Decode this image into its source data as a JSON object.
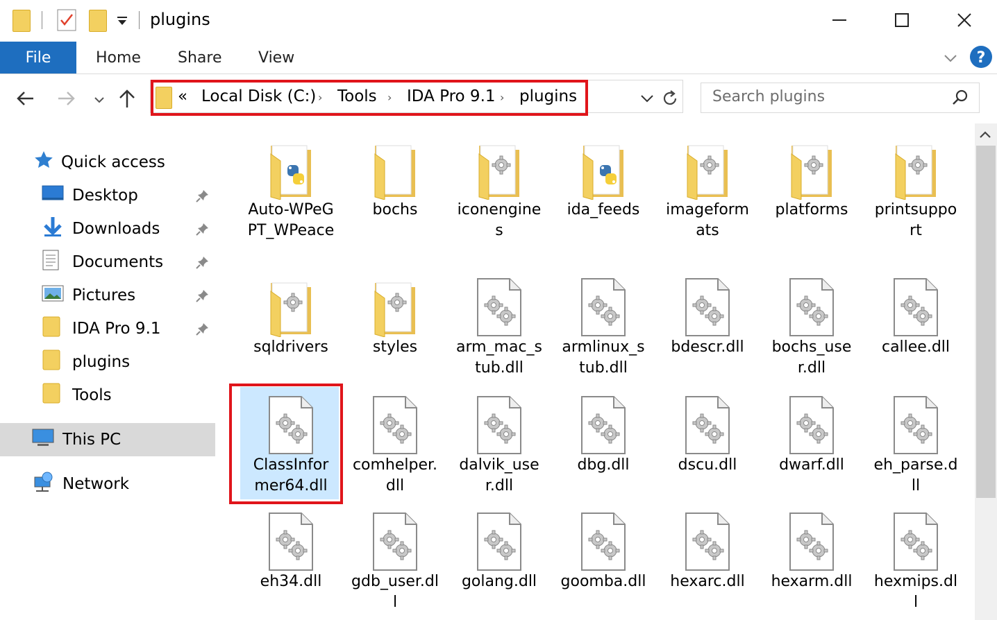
{
  "window": {
    "title": "plugins"
  },
  "ribbon": {
    "tabs": [
      "File",
      "Home",
      "Share",
      "View"
    ]
  },
  "address": {
    "overflow": "«",
    "crumbs": [
      "Local Disk (C:)",
      "Tools",
      "IDA Pro 9.1",
      "plugins"
    ]
  },
  "search": {
    "placeholder": "Search plugins"
  },
  "nav": {
    "quick_access": "Quick access",
    "items": [
      {
        "label": "Desktop",
        "icon": "desktop-icon",
        "pinned": true
      },
      {
        "label": "Downloads",
        "icon": "download-arrow-icon",
        "pinned": true
      },
      {
        "label": "Documents",
        "icon": "documents-icon",
        "pinned": true
      },
      {
        "label": "Pictures",
        "icon": "pictures-icon",
        "pinned": true
      },
      {
        "label": "IDA Pro 9.1",
        "icon": "folder-icon",
        "pinned": true
      },
      {
        "label": "plugins",
        "icon": "folder-icon",
        "pinned": false
      },
      {
        "label": "Tools",
        "icon": "folder-icon",
        "pinned": false
      }
    ],
    "this_pc": "This PC",
    "network": "Network"
  },
  "files": [
    {
      "name": "Auto-WPeGPT_WPeace",
      "type": "folder-python"
    },
    {
      "name": "bochs",
      "type": "folder"
    },
    {
      "name": "iconengines",
      "type": "folder-gear"
    },
    {
      "name": "ida_feeds",
      "type": "folder-python"
    },
    {
      "name": "imageformats",
      "type": "folder-gear"
    },
    {
      "name": "platforms",
      "type": "folder-gear"
    },
    {
      "name": "printsupport",
      "type": "folder-gear"
    },
    {
      "name": "sqldrivers",
      "type": "folder-gear"
    },
    {
      "name": "styles",
      "type": "folder-gear"
    },
    {
      "name": "arm_mac_stub.dll",
      "type": "dll"
    },
    {
      "name": "armlinux_stub.dll",
      "type": "dll"
    },
    {
      "name": "bdescr.dll",
      "type": "dll"
    },
    {
      "name": "bochs_user.dll",
      "type": "dll"
    },
    {
      "name": "callee.dll",
      "type": "dll"
    },
    {
      "name": "ClassInformer64.dll",
      "type": "dll",
      "selected": true
    },
    {
      "name": "comhelper.dll",
      "type": "dll"
    },
    {
      "name": "dalvik_user.dll",
      "type": "dll"
    },
    {
      "name": "dbg.dll",
      "type": "dll"
    },
    {
      "name": "dscu.dll",
      "type": "dll"
    },
    {
      "name": "dwarf.dll",
      "type": "dll"
    },
    {
      "name": "eh_parse.dll",
      "type": "dll"
    },
    {
      "name": "eh34.dll",
      "type": "dll"
    },
    {
      "name": "gdb_user.dll",
      "type": "dll"
    },
    {
      "name": "golang.dll",
      "type": "dll"
    },
    {
      "name": "goomba.dll",
      "type": "dll"
    },
    {
      "name": "hexarc.dll",
      "type": "dll"
    },
    {
      "name": "hexarm.dll",
      "type": "dll"
    },
    {
      "name": "hexmips.dll",
      "type": "dll"
    }
  ],
  "colors": {
    "accent": "#1e6ebf",
    "selection": "#cce8ff",
    "highlight": "#e0151b",
    "folder": "#f3d060"
  }
}
